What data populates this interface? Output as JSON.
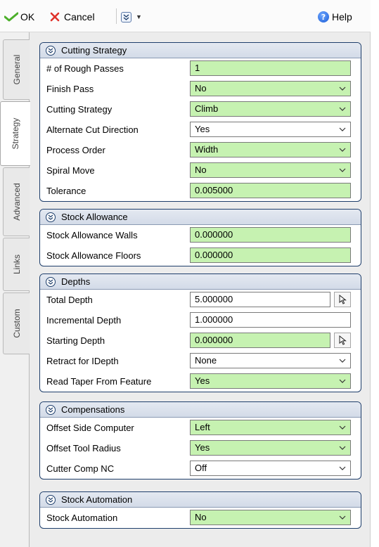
{
  "toolbar": {
    "ok_label": "OK",
    "cancel_label": "Cancel",
    "help_label": "Help"
  },
  "tabs": [
    {
      "label": "General",
      "active": false
    },
    {
      "label": "Strategy",
      "active": true
    },
    {
      "label": "Advanced",
      "active": false
    },
    {
      "label": "Links",
      "active": false
    },
    {
      "label": "Custom",
      "active": false
    }
  ],
  "colors": {
    "editable_field": "#c6f2b1",
    "group_border": "#1e3e6b",
    "ok_check": "#4caf2a",
    "cancel_x": "#e0322b"
  },
  "groups": {
    "cutting_strategy": {
      "title": "Cutting Strategy",
      "rows": [
        {
          "label": "# of Rough Passes",
          "value": "1"
        },
        {
          "label": "Finish Pass",
          "value": "No"
        },
        {
          "label": "Cutting Strategy",
          "value": "Climb"
        },
        {
          "label": "Alternate Cut Direction",
          "value": "Yes"
        },
        {
          "label": "Process Order",
          "value": "Width"
        },
        {
          "label": "Spiral Move",
          "value": "No"
        },
        {
          "label": "Tolerance",
          "value": "0.005000"
        }
      ]
    },
    "stock_allowance": {
      "title": "Stock Allowance",
      "rows": [
        {
          "label": "Stock Allowance Walls",
          "value": "0.000000"
        },
        {
          "label": "Stock Allowance Floors",
          "value": "0.000000"
        }
      ]
    },
    "depths": {
      "title": "Depths",
      "rows": [
        {
          "label": "Total Depth",
          "value": "5.000000"
        },
        {
          "label": "Incremental Depth",
          "value": "1.000000"
        },
        {
          "label": "Starting Depth",
          "value": "0.000000"
        },
        {
          "label": "Retract for IDepth",
          "value": "None"
        },
        {
          "label": "Read Taper From Feature",
          "value": "Yes"
        }
      ]
    },
    "compensations": {
      "title": "Compensations",
      "rows": [
        {
          "label": "Offset Side Computer",
          "value": "Left"
        },
        {
          "label": "Offset Tool Radius",
          "value": "Yes"
        },
        {
          "label": "Cutter Comp NC",
          "value": "Off"
        }
      ]
    },
    "stock_automation": {
      "title": "Stock Automation",
      "rows": [
        {
          "label": "Stock Automation",
          "value": "No"
        }
      ]
    }
  }
}
